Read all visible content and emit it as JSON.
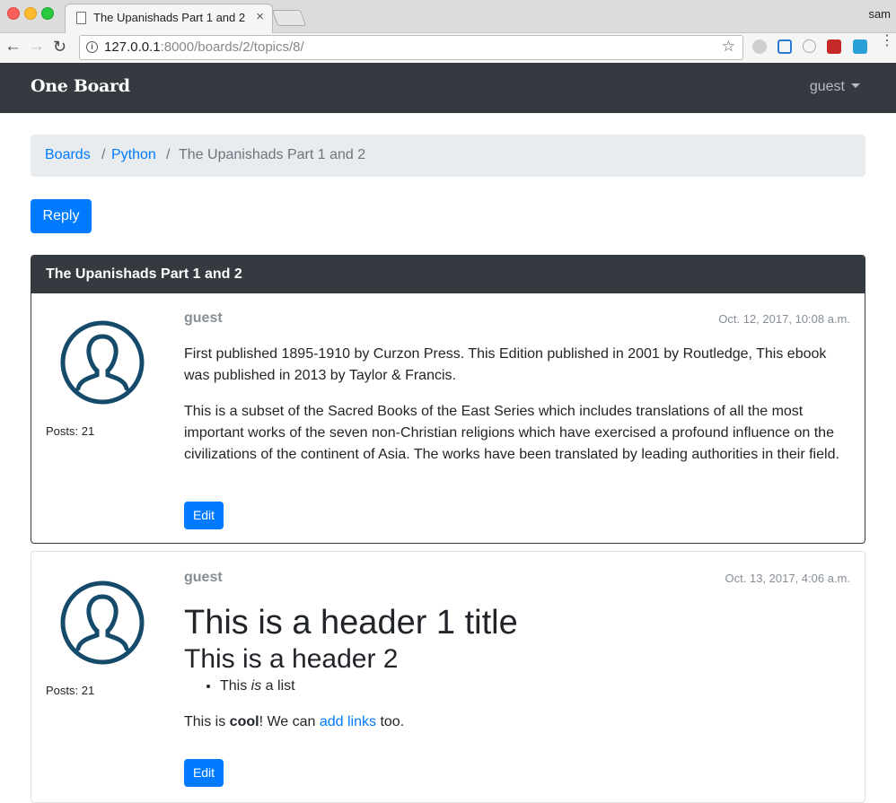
{
  "browser": {
    "tab_title": "The Upanishads Part 1 and 2",
    "user": "sam",
    "url_host": "127.0.0.1",
    "url_path": ":8000/boards/2/topics/8/",
    "tab_close": "×",
    "back": "←",
    "forward": "→",
    "reload": "↻",
    "star": "☆",
    "info": "i",
    "menu": "⋮"
  },
  "navbar": {
    "brand": "One Board",
    "user": "guest"
  },
  "breadcrumb": {
    "items": [
      "Boards",
      "Python",
      "The Upanishads Part 1 and 2"
    ],
    "separator": "/"
  },
  "reply_label": "Reply",
  "topic": {
    "title": "The Upanishads Part 1 and 2"
  },
  "posts": [
    {
      "author": "guest",
      "date": "Oct. 12, 2017, 10:08 a.m.",
      "posts_count": "Posts: 21",
      "paragraphs": [
        "First published 1895-1910 by Curzon Press. This Edition published in 2001 by Routledge, This ebook was published in 2013 by Taylor & Francis.",
        "This is a subset of the Sacred Books of the East Series which includes translations of all the most important works of the seven non-Christian religions which have exercised a profound influence on the civilizations of the continent of Asia. The works have been translated by leading authorities in their field."
      ],
      "edit_label": "Edit"
    },
    {
      "author": "guest",
      "date": "Oct. 13, 2017, 4:06 a.m.",
      "posts_count": "Posts: 21",
      "h1": "This is a header 1 title",
      "h2": "This is a header 2",
      "list_pre": "This ",
      "list_em": "is",
      "list_post": " a list",
      "p_pre": "This is ",
      "p_bold": "cool",
      "p_mid": "! We can ",
      "p_link": "add links",
      "p_post": " too.",
      "edit_label": "Edit"
    }
  ],
  "colors": {
    "primary": "#007bff",
    "dark": "#343a40",
    "muted": "#868e96",
    "avatar": "#164a6b"
  }
}
